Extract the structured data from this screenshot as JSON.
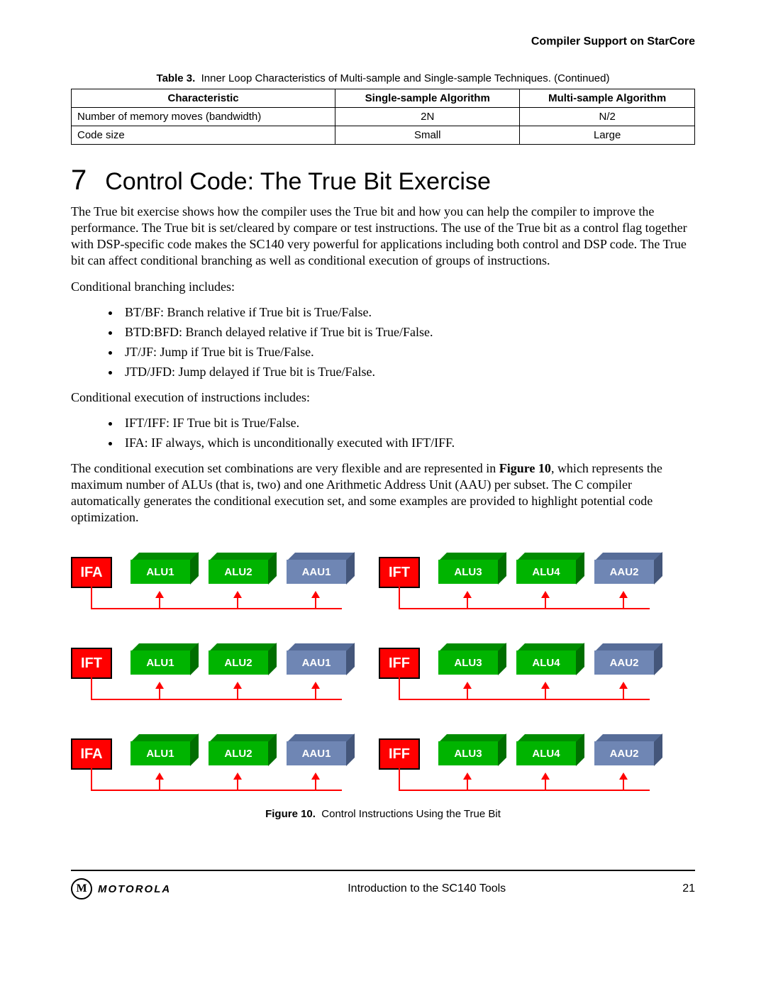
{
  "header": {
    "running_head": "Compiler Support on StarCore"
  },
  "table": {
    "caption_label": "Table 3.",
    "caption_text": "Inner Loop Characteristics of Multi-sample and Single-sample Techniques. (Continued)",
    "headers": [
      "Characteristic",
      "Single-sample Algorithm",
      "Multi-sample Algorithm"
    ],
    "rows": [
      {
        "c": "Number of memory moves (bandwidth)",
        "s": "2N",
        "m": "N/2"
      },
      {
        "c": "Code size",
        "s": "Small",
        "m": "Large"
      }
    ]
  },
  "section": {
    "number": "7",
    "title": "Control Code: The True Bit Exercise",
    "para1": "The True bit exercise shows how the compiler uses the True bit and how you can help the compiler to improve the performance. The True bit is set/cleared by compare or test instructions. The use of the True bit as a control flag together with DSP-specific code makes the SC140 very powerful for applications including both control and DSP code. The True bit can affect conditional branching as well as conditional execution of groups of instructions.",
    "para2": "Conditional branching includes:",
    "list1": [
      "BT/BF: Branch relative if True bit is True/False.",
      "BTD:BFD: Branch delayed relative if True bit is True/False.",
      "JT/JF: Jump if True bit is True/False.",
      "JTD/JFD: Jump delayed if True bit is True/False."
    ],
    "para3": "Conditional execution of instructions includes:",
    "list2": [
      "IFT/IFF: IF True bit is True/False.",
      "IFA: IF always, which is unconditionally executed with IFT/IFF."
    ],
    "para4_a": "The conditional execution set combinations are very flexible and are represented in ",
    "para4_ref": "Figure 10",
    "para4_b": ", which represents the maximum number of ALUs (that is, two) and one Arithmetic Address Unit (AAU) per subset. The C compiler automatically generates the conditional execution set, and some examples are provided to highlight potential code optimization."
  },
  "figure": {
    "caption_label": "Figure 10.",
    "caption_text": "Control Instructions Using the True Bit",
    "rows": [
      {
        "left": {
          "cond": "IFA",
          "b1": "ALU1",
          "b2": "ALU2",
          "b3": "AAU1"
        },
        "right": {
          "cond": "IFT",
          "b1": "ALU3",
          "b2": "ALU4",
          "b3": "AAU2"
        }
      },
      {
        "left": {
          "cond": "IFT",
          "b1": "ALU1",
          "b2": "ALU2",
          "b3": "AAU1"
        },
        "right": {
          "cond": "IFF",
          "b1": "ALU3",
          "b2": "ALU4",
          "b3": "AAU2"
        }
      },
      {
        "left": {
          "cond": "IFA",
          "b1": "ALU1",
          "b2": "ALU2",
          "b3": "AAU1"
        },
        "right": {
          "cond": "IFF",
          "b1": "ALU3",
          "b2": "ALU4",
          "b3": "AAU2"
        }
      }
    ]
  },
  "footer": {
    "brand": "MOTOROLA",
    "doc_title": "Introduction to the SC140 Tools",
    "page": "21"
  }
}
